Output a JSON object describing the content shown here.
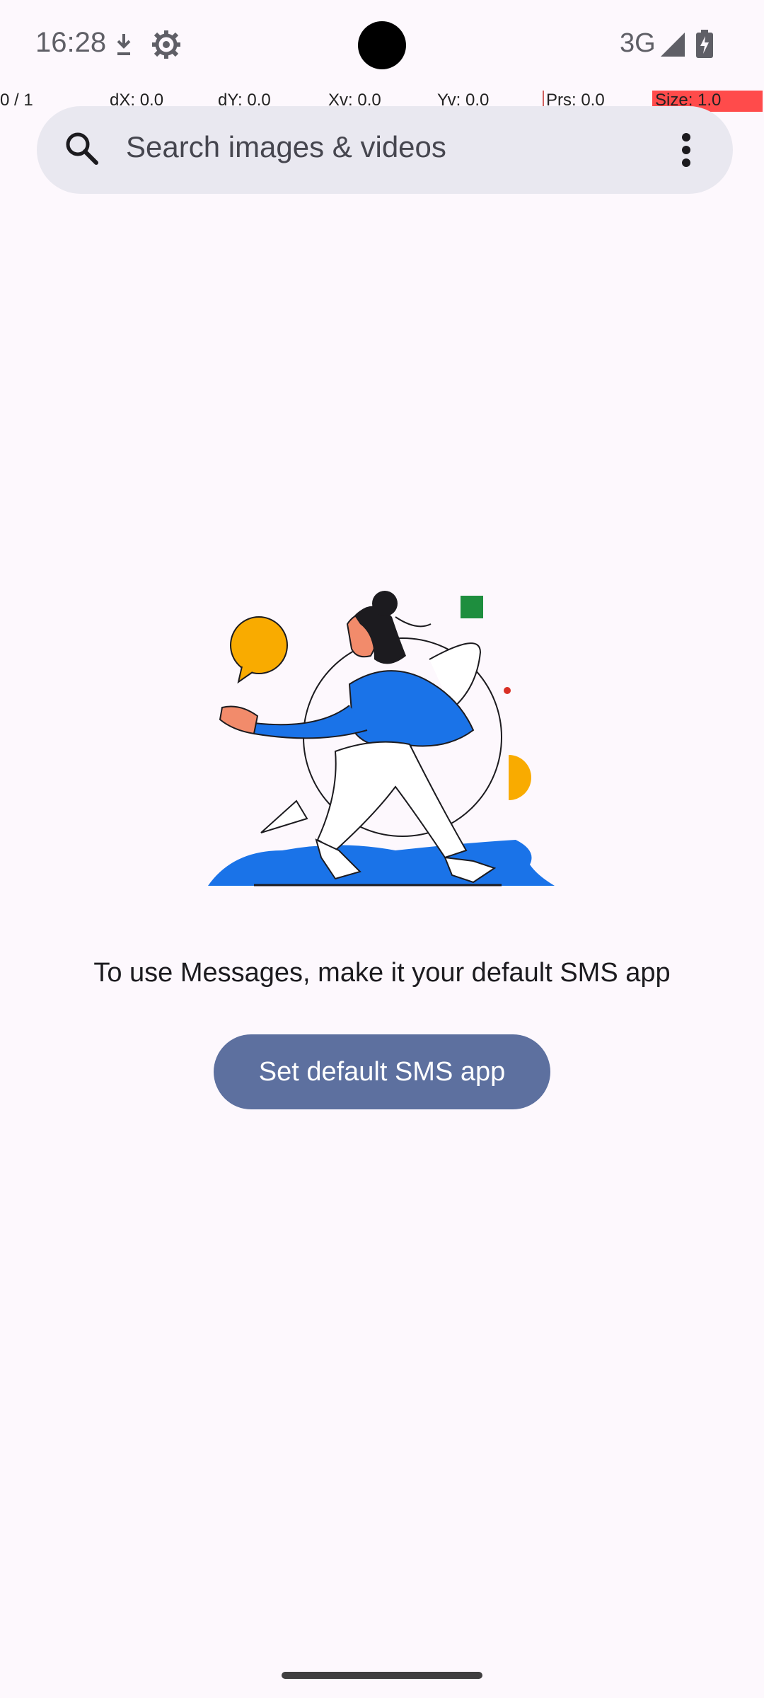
{
  "status_bar": {
    "time": "16:28",
    "network": "3G",
    "icons": [
      "download-icon",
      "gear-icon",
      "signal-icon",
      "battery-charging-icon"
    ]
  },
  "pointer_overlay": {
    "p": "0 / 1",
    "dx": "dX: 0.0",
    "dy": "dY: 0.0",
    "xv": "Xv: 0.0",
    "yv": "Yv: 0.0",
    "prs": "Prs: 0.0",
    "size": "Size: 1.0"
  },
  "search": {
    "placeholder": "Search images & videos",
    "icon": "search-icon",
    "menu_icon": "more-vert-icon"
  },
  "empty_state": {
    "message": "To use Messages, make it your default SMS app",
    "button_label": "Set default SMS app",
    "illustration": "person-with-speech-bubble-illustration"
  },
  "colors": {
    "background": "#fdf8fd",
    "search_bar": "#e9e8f0",
    "button": "#5d709f",
    "illustration_blue": "#1a73e8",
    "illustration_yellow": "#f9ab00",
    "illustration_green": "#1e8e3e",
    "overlay_red": "#ff4b4b"
  }
}
